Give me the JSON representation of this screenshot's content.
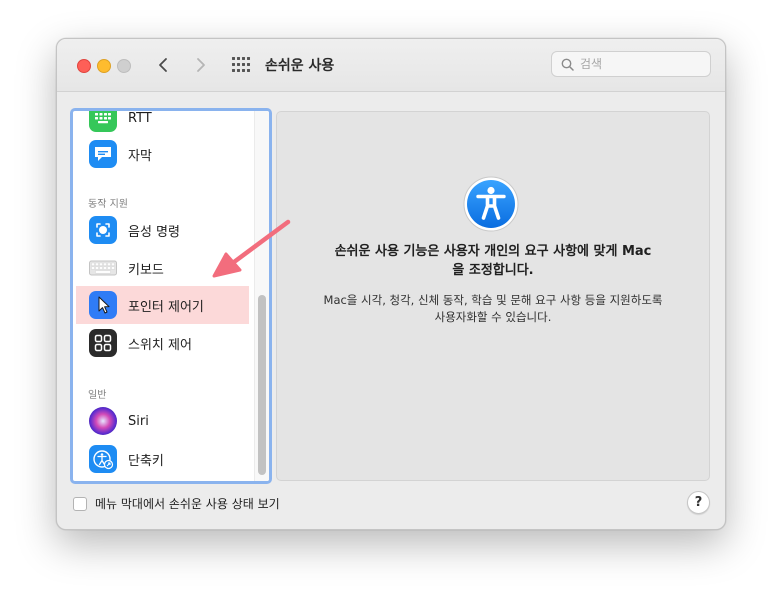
{
  "window": {
    "title": "손쉬운 사용",
    "search_placeholder": "검색"
  },
  "sidebar": {
    "items_top": [
      {
        "label": "RTT",
        "icon": "rtt-keyboard-icon",
        "color": "#35c759"
      },
      {
        "label": "자막",
        "icon": "captions-icon",
        "color": "#1e8cf3"
      }
    ],
    "section_motor": "동작 지원",
    "items_motor": [
      {
        "label": "음성 명령",
        "icon": "voice-control-icon",
        "color": "#1e8cf3"
      },
      {
        "label": "키보드",
        "icon": "keyboard-icon",
        "color": "#d8d8d8"
      },
      {
        "label": "포인터 제어기",
        "icon": "pointer-icon",
        "color": "#2f7cf6",
        "selected": true
      },
      {
        "label": "스위치 제어",
        "icon": "switch-control-icon",
        "color": "#2b2b2b"
      }
    ],
    "section_general": "일반",
    "items_general": [
      {
        "label": "Siri",
        "icon": "siri-icon",
        "color": "#7a3fd6"
      },
      {
        "label": "단축키",
        "icon": "shortcut-icon",
        "color": "#1e8cf3"
      }
    ]
  },
  "content": {
    "headline_line1": "손쉬운 사용 기능은 사용자 개인의 요구 사항에 맞게 Mac",
    "headline_line2": "을 조정합니다.",
    "desc_line1": "Mac을 시각, 청각, 신체 동작, 학습 및 문해 요구 사항 등을 지원하도록",
    "desc_line2": "사용자화할 수 있습니다.",
    "icon": "accessibility-icon"
  },
  "footer": {
    "checkbox_label": "메뉴 막대에서 손쉬운 사용 상태 보기",
    "checkbox_checked": false,
    "help_label": "?"
  },
  "colors": {
    "annotation_arrow": "#f26d7d",
    "selection_highlight": "#fcd9d9",
    "sidebar_focus": "#8ab3ee"
  }
}
